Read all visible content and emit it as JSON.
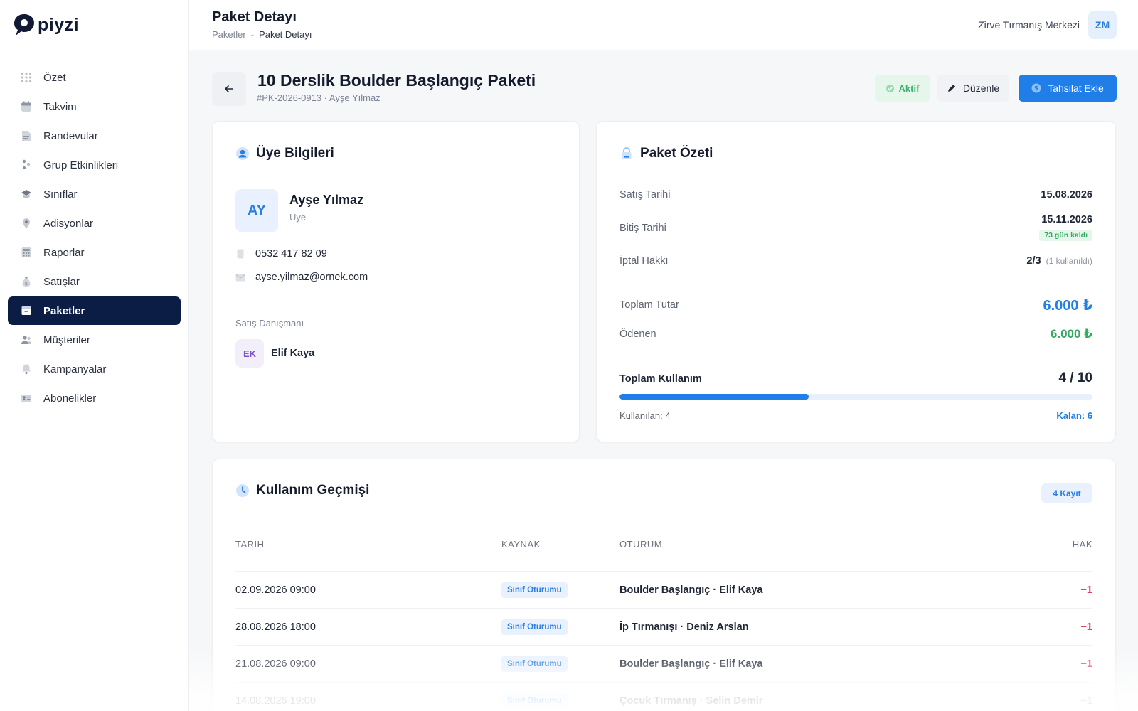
{
  "app": {
    "brand": "piyzi"
  },
  "sidebar": {
    "items": [
      {
        "label": "Özet",
        "icon": "grid-icon"
      },
      {
        "label": "Takvim",
        "icon": "calendar-icon"
      },
      {
        "label": "Randevular",
        "icon": "document-icon"
      },
      {
        "label": "Grup Etkinlikleri",
        "icon": "group-icon"
      },
      {
        "label": "Sınıflar",
        "icon": "graduation-cap-icon"
      },
      {
        "label": "Adisyonlar",
        "icon": "location-pin-icon"
      },
      {
        "label": "Raporlar",
        "icon": "calculator-icon"
      },
      {
        "label": "Satışlar",
        "icon": "money-bag-icon"
      },
      {
        "label": "Paketler",
        "icon": "package-icon",
        "active": true
      },
      {
        "label": "Müşteriler",
        "icon": "users-icon"
      },
      {
        "label": "Kampanyalar",
        "icon": "bell-icon"
      },
      {
        "label": "Abonelikler",
        "icon": "id-card-icon"
      }
    ]
  },
  "header": {
    "title": "Paket Detayı",
    "breadcrumb": [
      "Paketler",
      "Paket Detayı"
    ],
    "breadcrumb_sep": "-",
    "org_name": "Zirve Tırmanış Merkezi",
    "user_initials": "ZM"
  },
  "package": {
    "title": "10 Derslik Boulder Başlangıç Paketi",
    "subtitle": "#PK-2026-0913 · Ayşe Yılmaz",
    "status": "Aktif",
    "edit_label": "Düzenle",
    "pay_label": "Tahsilat Ekle"
  },
  "member": {
    "card_title": "Üye Bilgileri",
    "initials": "AY",
    "name": "Ayşe Yılmaz",
    "role": "Üye",
    "phone": "0532 417 82 09",
    "email": "ayse.yilmaz@ornek.com",
    "advisor_label": "Satış Danışmanı",
    "advisor_initials": "EK",
    "advisor_name": "Elif Kaya"
  },
  "summary": {
    "card_title": "Paket Özeti",
    "sale_date_label": "Satış Tarihi",
    "sale_date": "15.08.2026",
    "end_date_label": "Bitiş Tarihi",
    "end_date": "15.11.2026",
    "days_left": "73 gün kaldı",
    "cancel_label": "İptal Hakkı",
    "cancel_value": "2/3",
    "cancel_note": "(1 kullanıldı)",
    "total_label": "Toplam Tutar",
    "total_value": "6.000 ₺",
    "paid_label": "Ödenen",
    "paid_value": "6.000 ₺",
    "usage_label": "Toplam Kullanım",
    "usage_value": "4 / 10",
    "usage_used": 4,
    "usage_total": 10,
    "used_text": "Kullanılan: 4",
    "remaining_text": "Kalan: 6"
  },
  "history": {
    "card_title": "Kullanım Geçmişi",
    "count_badge": "4 Kayıt",
    "columns": [
      "TARİH",
      "KAYNAK",
      "OTURUM",
      "HAK"
    ],
    "rows": [
      {
        "date": "02.09.2026 09:00",
        "source": "Sınıf Oturumu",
        "session": "Boulder Başlangıç · Elif Kaya",
        "hak": "−1"
      },
      {
        "date": "28.08.2026 18:00",
        "source": "Sınıf Oturumu",
        "session": "İp Tırmanışı · Deniz Arslan",
        "hak": "−1"
      },
      {
        "date": "21.08.2026 09:00",
        "source": "Sınıf Oturumu",
        "session": "Boulder Başlangıç · Elif Kaya",
        "hak": "−1"
      },
      {
        "date": "14.08.2026 19:00",
        "source": "Sınıf Oturumu",
        "session": "Çocuk Tırmanış · Selin Demir",
        "hak": "−1"
      }
    ]
  },
  "colors": {
    "brand_navy": "#0c1d45",
    "accent_blue": "#1f7ee8",
    "success_green": "#36a862",
    "danger_red": "#e0405c"
  }
}
